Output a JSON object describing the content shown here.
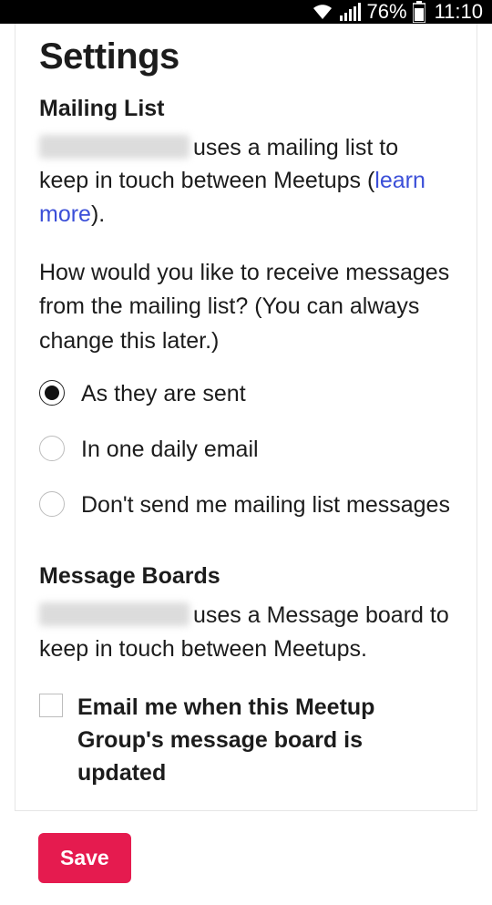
{
  "status": {
    "battery_pct": "76%",
    "time": "11:10"
  },
  "title": "Settings",
  "mailing_list": {
    "heading": "Mailing List",
    "desc_prefix": "uses a mailing list to keep in touch between Meetups (",
    "learn_more": "learn more",
    "desc_suffix": ").",
    "question": "How would you like to receive messages from the mailing list? (You can always change this later.)",
    "options": [
      {
        "label": "As they are sent",
        "selected": true
      },
      {
        "label": "In one daily email",
        "selected": false
      },
      {
        "label": "Don't send me mailing list messages",
        "selected": false
      }
    ]
  },
  "message_boards": {
    "heading": "Message Boards",
    "desc": "uses a Message board to keep in touch between Meetups.",
    "checkbox_label": "Email me when this Meetup Group's message board is updated",
    "checked": false
  },
  "save_label": "Save"
}
